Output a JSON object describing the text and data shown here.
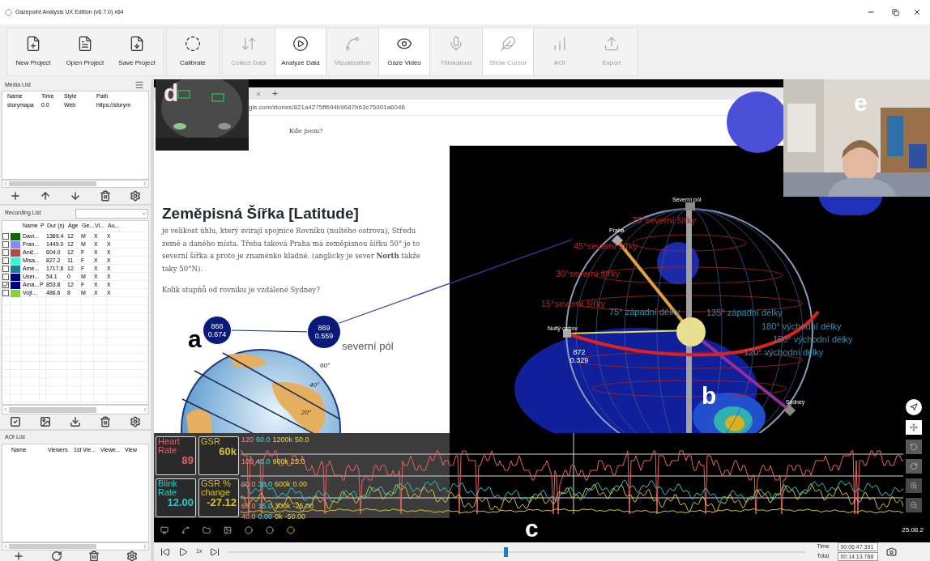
{
  "window": {
    "title": "Gazepoint Analysis UX Edition (v6.7.0) x64"
  },
  "toolbar": [
    {
      "buttons": [
        {
          "label": "New Project",
          "kind": "new_project",
          "selected": false,
          "disabled": false
        },
        {
          "label": "Open Project",
          "kind": "open_project",
          "selected": false,
          "disabled": false
        },
        {
          "label": "Save Project",
          "kind": "save_project",
          "selected": false,
          "disabled": false
        }
      ]
    },
    {
      "buttons": [
        {
          "label": "Calibrate",
          "kind": "calibrate",
          "selected": false,
          "disabled": false
        }
      ]
    },
    {
      "buttons": [
        {
          "label": "Collect Data",
          "kind": "collect",
          "selected": false,
          "disabled": true
        },
        {
          "label": "Analyze Data",
          "kind": "analyze",
          "selected": true,
          "disabled": false
        },
        {
          "label": "Visualization",
          "kind": "visualization",
          "selected": false,
          "disabled": true
        },
        {
          "label": "Gaze Video",
          "kind": "gaze_video",
          "selected": true,
          "disabled": false
        },
        {
          "label": "Thinkaloud",
          "kind": "thinkaloud",
          "selected": false,
          "disabled": true
        },
        {
          "label": "Show Cursor",
          "kind": "show_cursor",
          "selected": true,
          "disabled": true
        },
        {
          "label": "AOI",
          "kind": "aoi",
          "selected": false,
          "disabled": true
        },
        {
          "label": "Export",
          "kind": "export",
          "selected": false,
          "disabled": true
        }
      ]
    }
  ],
  "media_list": {
    "title": "Media List",
    "columns": [
      "Name",
      "Time",
      "Style",
      "Path"
    ],
    "rows": [
      [
        "storymapa",
        "0.0",
        "Web",
        "https://storym"
      ]
    ]
  },
  "recording_list": {
    "title": "Recording List",
    "columns": [
      "Name",
      "P",
      "Dur (s)",
      "Age",
      "Ge...",
      "Vi...",
      "Au..."
    ],
    "rows": [
      {
        "checked": false,
        "color": "#0b650b",
        "name": "Davi...",
        "dur": "1369.4",
        "age": "12",
        "gender": "M",
        "vi": "X",
        "au": "X"
      },
      {
        "checked": false,
        "color": "#8888ff",
        "name": "Fran...",
        "dur": "1449.0",
        "age": "12",
        "gender": "M",
        "vi": "X",
        "au": "X"
      },
      {
        "checked": false,
        "color": "#b04a4a",
        "name": "Anič...",
        "dur": "604.0",
        "age": "12",
        "gender": "F",
        "vi": "X",
        "au": "X"
      },
      {
        "checked": false,
        "color": "#3cf5cf",
        "name": "Misa...",
        "dur": "827.2",
        "age": "11",
        "gender": "F",
        "vi": "X",
        "au": "X"
      },
      {
        "checked": false,
        "color": "#1a8090",
        "name": "Amé...",
        "dur": "1717.6",
        "age": "12",
        "gender": "F",
        "vi": "X",
        "au": "X"
      },
      {
        "checked": false,
        "color": "#000080",
        "name": "User...",
        "dur": "54.1",
        "age": "0",
        "gender": "M",
        "vi": "X",
        "au": "X"
      },
      {
        "checked": true,
        "color": "#000080",
        "name": "Amá...",
        "p": "P",
        "dur": "853.8",
        "age": "12",
        "gender": "F",
        "vi": "X",
        "au": "X"
      },
      {
        "checked": false,
        "color": "#84d040",
        "name": "Vojt...",
        "dur": "486.6",
        "age": "8",
        "gender": "M",
        "vi": "X",
        "au": "X"
      }
    ]
  },
  "aoi_list": {
    "title": "AOI List",
    "columns": [
      "Name",
      "Viewers",
      "1st Vie...",
      "Viewe...",
      "View"
    ]
  },
  "video": {
    "browser": {
      "url": "gis.com/stories/821a4275ff694b9687b63c75001a6046",
      "nav_link": "Kde jsem?"
    },
    "article": {
      "heading": "Zeměpisná Šířka [Latitude]",
      "paragraph": "je velikost úhlu, který svírají spojnice Rovníku (nultého ostrova), Středu země a daného místa. Třeba taková Praha má zeměpisnou šířku 50° je to severní šířka a proto je znaménko kladné. (anglicky je sever **North** takže taky 50°N).",
      "question": "Kolik stupňů od rovníku je vzdálené Sydney?",
      "caption": "severní pól",
      "marks": [
        "60°",
        "40°",
        "20°"
      ]
    },
    "gaze_points": [
      {
        "count": "868",
        "value": "0.674"
      },
      {
        "count": "869",
        "value": "0.559"
      },
      {
        "count": "872",
        "value": "0.329"
      }
    ],
    "globe_labels": [
      {
        "text": "Severní pól",
        "kind": "place"
      },
      {
        "text": "Praha",
        "kind": "place"
      },
      {
        "text": "75°severní šířky",
        "kind": "latitude"
      },
      {
        "text": "45°severní šířky",
        "kind": "latitude"
      },
      {
        "text": "30°severní šířky",
        "kind": "latitude"
      },
      {
        "text": "15°severní šířky",
        "kind": "latitude"
      },
      {
        "text": "75° západní délky",
        "kind": "longitude"
      },
      {
        "text": "135° západní délky",
        "kind": "longitude"
      },
      {
        "text": "180° východní délky",
        "kind": "longitude"
      },
      {
        "text": "150° východní délky",
        "kind": "longitude"
      },
      {
        "text": "120° východní délky",
        "kind": "longitude"
      },
      {
        "text": "Nultý ostrov",
        "kind": "place"
      },
      {
        "text": "Sydney",
        "kind": "place"
      }
    ],
    "biometrics": {
      "meters": [
        {
          "label": "Heart Rate",
          "value": "89",
          "color": "#e86060"
        },
        {
          "label": "GSR",
          "value": "60k",
          "color": "#d8c030"
        },
        {
          "label": "Blink Rate",
          "value": "12.00",
          "color": "#30c8c8"
        },
        {
          "label": "GSR % change",
          "value": "-27.12",
          "color": "#d8c030"
        }
      ],
      "tick_rows": [
        [
          "120",
          "60.0",
          "1200k",
          "50.0"
        ],
        [
          "100",
          "45.0",
          "900k",
          "25.0"
        ],
        [
          "80.0",
          "30.0",
          "600k",
          "0.00"
        ],
        [
          "60.0",
          "15.0",
          "300k",
          "-25.00"
        ],
        [
          "40.0",
          "0.00",
          "0k",
          "-50.00"
        ]
      ]
    },
    "taskbar_date": "25.08.2",
    "figure_labels": [
      "a",
      "b",
      "c",
      "d",
      "e"
    ]
  },
  "playback": {
    "speed": "1x",
    "level": 0.48,
    "time_label": "Time",
    "time": "00:06:47.391",
    "total_label": "Total",
    "total": "00:14:13.788"
  }
}
